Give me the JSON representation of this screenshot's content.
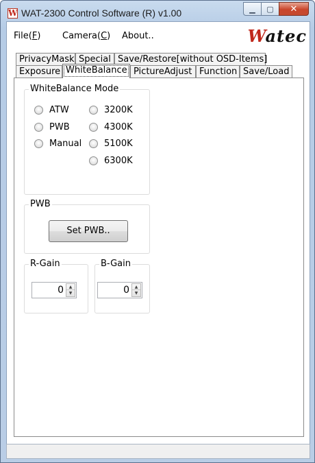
{
  "window": {
    "title": "WAT-2300 Control Software (R) v1.00",
    "app_icon_glyph": "W",
    "controls": {
      "minimize": "▁",
      "maximize": "▢",
      "close": "✕"
    }
  },
  "menu": {
    "file_prefix": "File(",
    "file_key": "F",
    "file_suffix": ")",
    "camera_prefix": "Camera(",
    "camera_key": "C",
    "camera_suffix": ")",
    "about": "About..",
    "logo_w": "W",
    "logo_rest": "atec"
  },
  "tabs": {
    "row1": [
      "PrivacyMask",
      "Special",
      "Save/Restore[without OSD-Items]"
    ],
    "row2": [
      "Exposure",
      "WhiteBalance",
      "PictureAdjust",
      "Function",
      "Save/Load"
    ],
    "active": "WhiteBalance"
  },
  "whitebalance": {
    "mode_title": "WhiteBalance Mode",
    "modes_left": [
      "ATW",
      "PWB",
      "Manual"
    ],
    "modes_right": [
      "3200K",
      "4300K",
      "5100K",
      "6300K"
    ],
    "pwb_title": "PWB",
    "set_pwb_label": "Set PWB..",
    "rgain_title": "R-Gain",
    "rgain_value": "0",
    "bgain_title": "B-Gain",
    "bgain_value": "0"
  },
  "status": {
    "text": ""
  }
}
